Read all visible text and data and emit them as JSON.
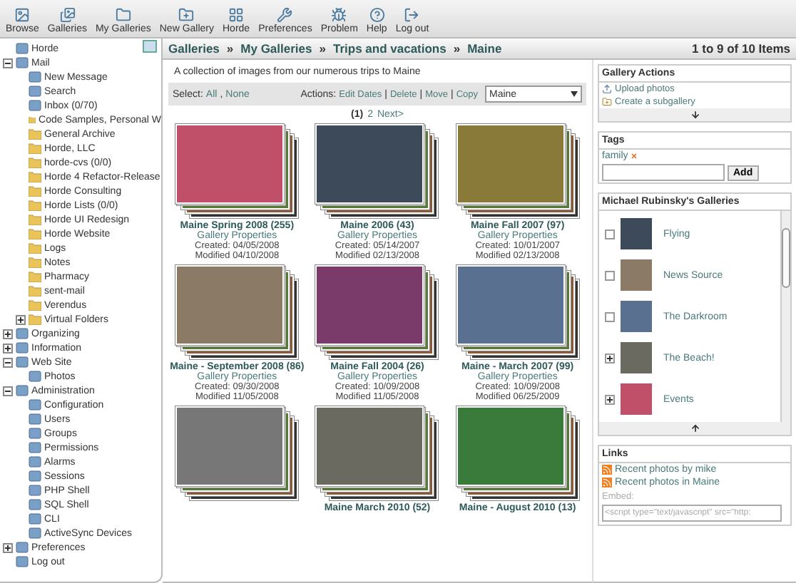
{
  "toolbar": [
    "Browse",
    "Galleries",
    "My Galleries",
    "New Gallery",
    "Horde",
    "Preferences",
    "Problem",
    "Help",
    "Log out"
  ],
  "sidebar": {
    "tree": [
      {
        "label": "Horde",
        "kind": "app"
      },
      {
        "label": "Mail",
        "kind": "app",
        "expanded": true,
        "children": [
          {
            "label": "New Message",
            "kind": "app"
          },
          {
            "label": "Search",
            "kind": "app"
          },
          {
            "label": "Inbox (0/70)",
            "kind": "app"
          },
          {
            "label": "Code Samples, Personal W",
            "kind": "folder"
          },
          {
            "label": "General Archive",
            "kind": "folder"
          },
          {
            "label": "Horde, LLC",
            "kind": "folder"
          },
          {
            "label": "horde-cvs (0/0)",
            "kind": "folder"
          },
          {
            "label": "Horde 4 Refactor-Release",
            "kind": "folder"
          },
          {
            "label": "Horde Consulting",
            "kind": "folder"
          },
          {
            "label": "Horde Lists (0/0)",
            "kind": "folder"
          },
          {
            "label": "Horde UI Redesign",
            "kind": "folder"
          },
          {
            "label": "Horde Website",
            "kind": "folder"
          },
          {
            "label": "Logs",
            "kind": "folder"
          },
          {
            "label": "Notes",
            "kind": "folder"
          },
          {
            "label": "Pharmacy",
            "kind": "folder"
          },
          {
            "label": "sent-mail",
            "kind": "folder"
          },
          {
            "label": "Verendus",
            "kind": "folder"
          },
          {
            "label": "Virtual Folders",
            "kind": "folder",
            "expanded": false
          }
        ]
      },
      {
        "label": "Organizing",
        "kind": "app",
        "expanded": false
      },
      {
        "label": "Information",
        "kind": "app",
        "expanded": false
      },
      {
        "label": "Web Site",
        "kind": "app",
        "expanded": true,
        "children": [
          {
            "label": "Photos",
            "kind": "app"
          }
        ]
      },
      {
        "label": "Administration",
        "kind": "app",
        "expanded": true,
        "children": [
          {
            "label": "Configuration",
            "kind": "app"
          },
          {
            "label": "Users",
            "kind": "app"
          },
          {
            "label": "Groups",
            "kind": "app"
          },
          {
            "label": "Permissions",
            "kind": "app"
          },
          {
            "label": "Alarms",
            "kind": "app"
          },
          {
            "label": "Sessions",
            "kind": "app"
          },
          {
            "label": "PHP Shell",
            "kind": "app"
          },
          {
            "label": "SQL Shell",
            "kind": "app"
          },
          {
            "label": "CLI",
            "kind": "app"
          },
          {
            "label": "ActiveSync Devices",
            "kind": "app"
          }
        ]
      },
      {
        "label": "Preferences",
        "kind": "app",
        "expanded": false
      },
      {
        "label": "Log out",
        "kind": "app"
      }
    ]
  },
  "breadcrumb": {
    "items": [
      "Galleries",
      "My Galleries",
      "Trips and vacations",
      "Maine"
    ],
    "separator": "»"
  },
  "item_count": "1 to 9 of 10 Items",
  "description": "A collection of images from our numerous trips to Maine",
  "select_bar": {
    "select_label": "Select:",
    "select_links": [
      "All",
      "None"
    ],
    "select_separator": ",",
    "actions_label": "Actions:",
    "actions": [
      "Edit Dates",
      "Delete",
      "Move",
      "Copy"
    ],
    "actions_separator": "|",
    "target": "Maine"
  },
  "pager": {
    "current": "(1)",
    "pages": [
      "2"
    ],
    "next": "Next>"
  },
  "galleries": [
    {
      "title": "Maine Spring 2008 (255)",
      "properties": "Gallery Properties",
      "created": "Created: 04/05/2008",
      "modified": "Modified 04/10/2008"
    },
    {
      "title": "Maine 2006 (43)",
      "properties": "Gallery Properties",
      "created": "Created: 05/14/2007",
      "modified": "Modified 02/13/2008"
    },
    {
      "title": "Maine Fall 2007 (97)",
      "properties": "Gallery Properties",
      "created": "Created: 10/01/2007",
      "modified": "Modified 02/13/2008"
    },
    {
      "title": "Maine - September 2008 (86)",
      "properties": "Gallery Properties",
      "created": "Created: 09/30/2008",
      "modified": "Modified 11/05/2008"
    },
    {
      "title": "Maine Fall 2004 (26)",
      "properties": "Gallery Properties",
      "created": "Created: 10/09/2008",
      "modified": "Modified 11/05/2008"
    },
    {
      "title": "Maine - March 2007 (99)",
      "properties": "Gallery Properties",
      "created": "Created: 10/09/2008",
      "modified": "Modified 06/25/2009"
    },
    {
      "kind": "photo"
    },
    {
      "title": "Maine March 2010 (52)"
    },
    {
      "title": "Maine - August 2010 (13)"
    }
  ],
  "gallery_actions": {
    "title": "Gallery Actions",
    "items": [
      "Upload photos",
      "Create a subgallery"
    ]
  },
  "tags": {
    "title": "Tags",
    "items": [
      "family"
    ],
    "button": "Add"
  },
  "user_galleries": {
    "title": "Michael Rubinsky's Galleries",
    "items": [
      {
        "name": "Flying",
        "has_children": false
      },
      {
        "name": "News Source",
        "has_children": false
      },
      {
        "name": "The Darkroom",
        "has_children": false
      },
      {
        "name": "The Beach!",
        "has_children": true
      },
      {
        "name": "Events",
        "has_children": true
      }
    ]
  },
  "links": {
    "title": "Links",
    "items": [
      "Recent photos by mike",
      "Recent photos in Maine"
    ],
    "embed_label": "Embed:",
    "embed_code": "<script type=\"text/javascript\" src=\"http:"
  }
}
